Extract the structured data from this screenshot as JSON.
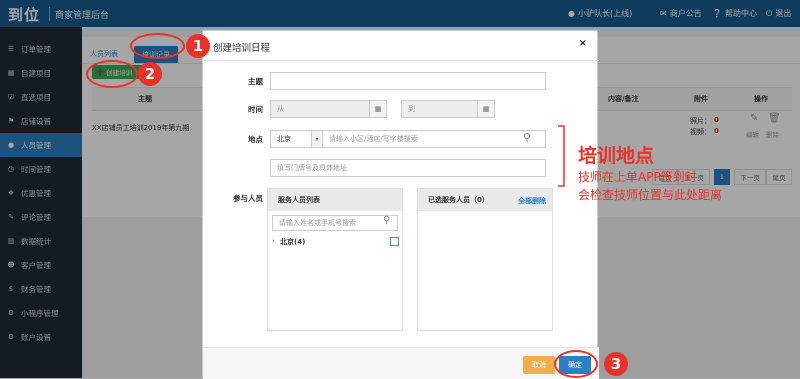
{
  "header": {
    "logo": "到位",
    "app_name": "商家管理后台",
    "user": "小驴队长(上线)",
    "notice": "商户公告",
    "help": "帮助中心",
    "logout": "退出"
  },
  "sidebar": {
    "items": [
      {
        "label": "订单管理",
        "icon": "list-icon"
      },
      {
        "label": "自建项目",
        "icon": "grid-icon"
      },
      {
        "label": "直选项目",
        "icon": "check-square-icon"
      },
      {
        "label": "店铺设置",
        "icon": "shop-icon"
      },
      {
        "label": "人员管理",
        "icon": "user-icon",
        "active": true
      },
      {
        "label": "时间管理",
        "icon": "clock-icon"
      },
      {
        "label": "优惠管理",
        "icon": "tag-icon"
      },
      {
        "label": "评论管理",
        "icon": "comment-icon"
      },
      {
        "label": "数据统计",
        "icon": "bar-chart-icon"
      },
      {
        "label": "客户管理",
        "icon": "users-icon"
      },
      {
        "label": "财务管理",
        "icon": "dollar-icon"
      },
      {
        "label": "小程序管理",
        "icon": "app-icon"
      },
      {
        "label": "账户设置",
        "icon": "gear-icon"
      }
    ]
  },
  "tabs": {
    "staff_list": "人员列表",
    "training": "培训记录"
  },
  "create_button": "创建培训",
  "table": {
    "headers": {
      "subject": "主题",
      "content": "内容/备注",
      "attachment": "附件",
      "action": "操作"
    },
    "row": {
      "subject": "XX店铺员工培训2019年第九期",
      "photos_label": "照片：",
      "photos": "0",
      "videos_label": "视频：",
      "videos": "0",
      "edit": "编辑",
      "delete": "删除"
    }
  },
  "pagination": {
    "first": "首页",
    "prev": "上一页",
    "current": "1",
    "next": "下一页",
    "last": "尾页"
  },
  "modal": {
    "title": "创建培训日程",
    "close": "×",
    "subject_label": "主题",
    "time_label": "时间",
    "time_from": "从",
    "time_to": "到",
    "location_label": "地点",
    "city": "北京",
    "location_placeholder": "请输入小区/酒店/写字楼搜索",
    "address_placeholder": "填写门牌号及具体地址",
    "participants_label": "参与人员",
    "staff_list_title": "服务人员列表",
    "staff_search_placeholder": "请输入姓名或手机号搜索",
    "tree_node": "北京(4)",
    "selected_title": "已选服务人员（0）",
    "delete_all": "全部删除",
    "cancel": "取消",
    "confirm": "确定"
  },
  "annotations": {
    "title": "培训地点",
    "line1": "技师在上单APP签到时",
    "line2": "会检查技师位置与此处距离",
    "n1": "1",
    "n2": "2",
    "n3": "3"
  },
  "colors": {
    "header": "#175b8f",
    "sidebar": "#1f2a35",
    "accent": "#2d7fc1",
    "annotation": "#e8322a",
    "confirm": "#2d7fc1",
    "cancel": "#f0ad4e",
    "create": "#3daa55"
  }
}
